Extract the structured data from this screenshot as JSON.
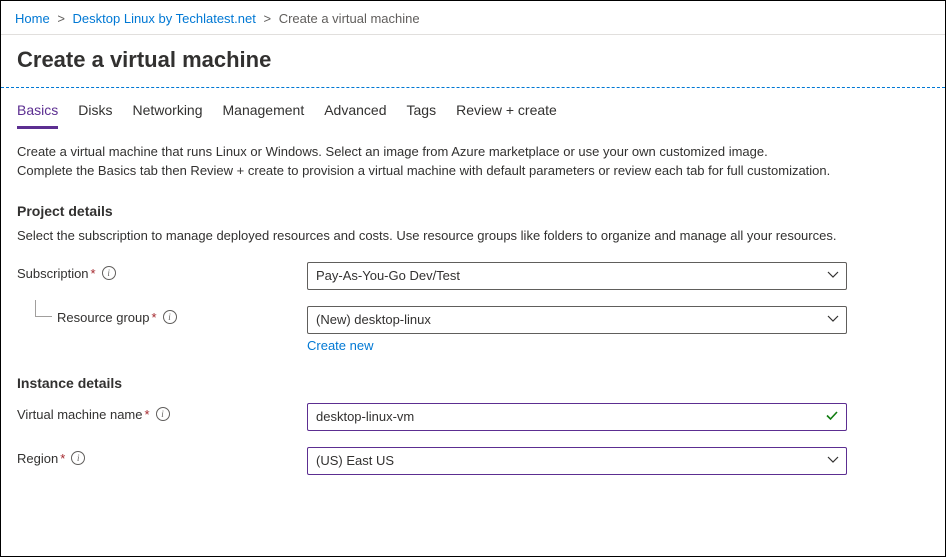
{
  "breadcrumb": {
    "home": "Home",
    "parent": "Desktop Linux by Techlatest.net",
    "current": "Create a virtual machine"
  },
  "page_title": "Create a virtual machine",
  "tabs": {
    "basics": "Basics",
    "disks": "Disks",
    "networking": "Networking",
    "management": "Management",
    "advanced": "Advanced",
    "tags": "Tags",
    "review": "Review + create"
  },
  "intro": {
    "p1": "Create a virtual machine that runs Linux or Windows. Select an image from Azure marketplace or use your own customized image.",
    "p2": "Complete the Basics tab then Review + create to provision a virtual machine with default parameters or review each tab for full customization."
  },
  "project": {
    "header": "Project details",
    "desc": "Select the subscription to manage deployed resources and costs. Use resource groups like folders to organize and manage all your resources.",
    "subscription_label": "Subscription",
    "subscription_value": "Pay-As-You-Go Dev/Test",
    "rg_label": "Resource group",
    "rg_value": "(New) desktop-linux",
    "create_new": "Create new"
  },
  "instance": {
    "header": "Instance details",
    "vmname_label": "Virtual machine name",
    "vmname_value": "desktop-linux-vm",
    "region_label": "Region",
    "region_value": "(US) East US"
  }
}
